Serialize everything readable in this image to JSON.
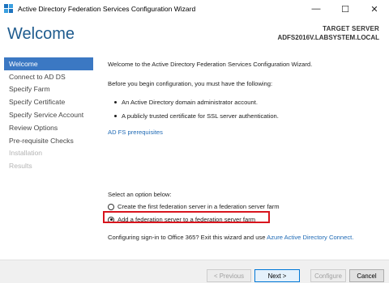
{
  "window": {
    "title": "Active Directory Federation Services Configuration Wizard",
    "controls": {
      "minimize": "—",
      "maximize": "☐",
      "close": "✕"
    }
  },
  "header": {
    "title": "Welcome",
    "target_label": "TARGET SERVER",
    "target_value": "ADFS2016V.LABSYSTEM.LOCAL"
  },
  "sidebar": {
    "items": [
      {
        "label": "Welcome",
        "state": "active"
      },
      {
        "label": "Connect to AD DS",
        "state": "enabled"
      },
      {
        "label": "Specify Farm",
        "state": "enabled"
      },
      {
        "label": "Specify Certificate",
        "state": "enabled"
      },
      {
        "label": "Specify Service Account",
        "state": "enabled"
      },
      {
        "label": "Review Options",
        "state": "enabled"
      },
      {
        "label": "Pre-requisite Checks",
        "state": "enabled"
      },
      {
        "label": "Installation",
        "state": "disabled"
      },
      {
        "label": "Results",
        "state": "disabled"
      }
    ]
  },
  "content": {
    "intro": "Welcome to the Active Directory Federation Services Configuration Wizard.",
    "before": "Before you begin configuration, you must have the following:",
    "bullets": [
      "An Active Directory domain administrator account.",
      "A publicly trusted certificate for SSL server authentication."
    ],
    "prereq_link": "AD FS prerequisites",
    "select_label": "Select an option below:",
    "options": [
      {
        "label": "Create the first federation server in a federation server farm",
        "checked": false
      },
      {
        "label": "Add a federation server to a federation server farm",
        "checked": true
      }
    ],
    "office_text": "Configuring sign-in to Office 365? Exit this wizard and use",
    "office_link": "Azure Active Directory Connect."
  },
  "footer": {
    "previous": "< Previous",
    "next": "Next >",
    "configure": "Configure",
    "cancel": "Cancel"
  },
  "colors": {
    "accent": "#3b78c3",
    "heading": "#1e5b8e",
    "link": "#1f6ab5",
    "highlight": "#d8141d"
  }
}
